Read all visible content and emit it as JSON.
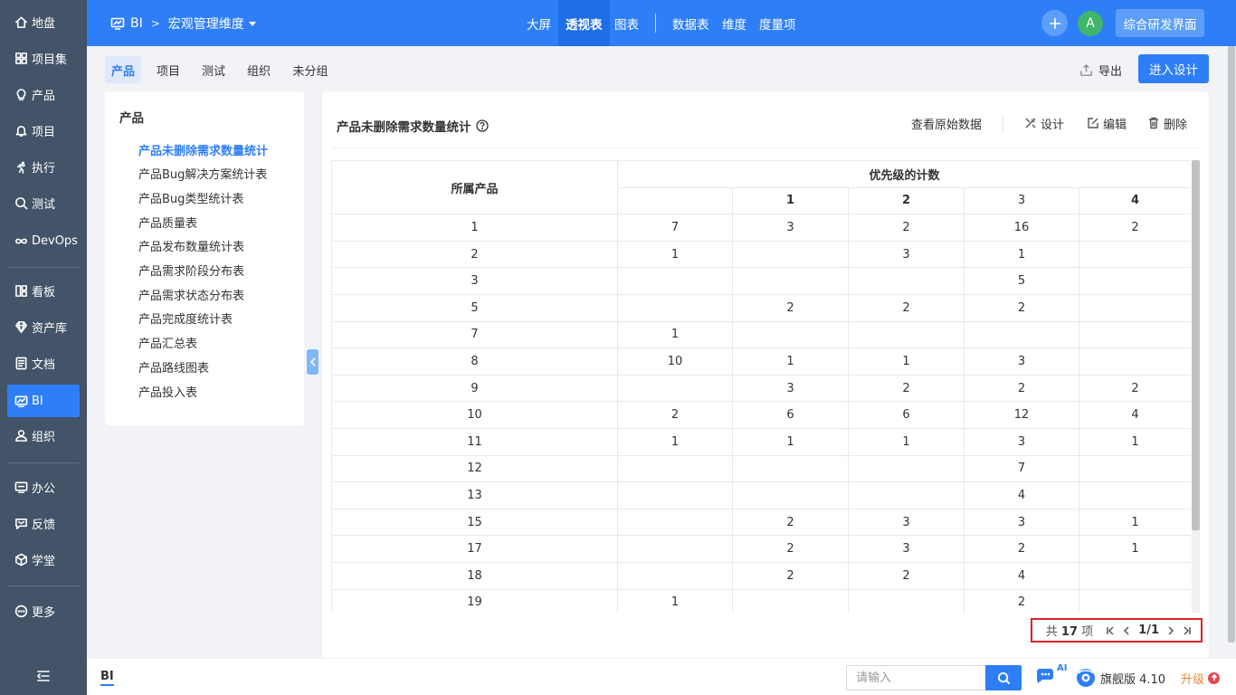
{
  "sidebar": {
    "items": [
      {
        "label": "地盘",
        "icon": "home-icon"
      },
      {
        "label": "项目集",
        "icon": "grid-icon"
      },
      {
        "label": "产品",
        "icon": "lightbulb-icon"
      },
      {
        "label": "项目",
        "icon": "bell-icon"
      },
      {
        "label": "执行",
        "icon": "run-icon"
      },
      {
        "label": "测试",
        "icon": "magnifier-icon"
      },
      {
        "label": "DevOps",
        "icon": "infinity-icon"
      },
      {
        "label": "看板",
        "icon": "board-icon"
      },
      {
        "label": "资产库",
        "icon": "diamond-icon"
      },
      {
        "label": "文档",
        "icon": "document-icon"
      },
      {
        "label": "BI",
        "icon": "monitor-icon",
        "active": true
      },
      {
        "label": "组织",
        "icon": "user-icon"
      },
      {
        "label": "办公",
        "icon": "oa-icon"
      },
      {
        "label": "反馈",
        "icon": "feedback-icon"
      },
      {
        "label": "学堂",
        "icon": "cube-icon"
      },
      {
        "label": "更多",
        "icon": "more-icon"
      }
    ]
  },
  "header": {
    "app": "BI",
    "crumb": "宏观管理维度",
    "nav": [
      {
        "label": "大屏"
      },
      {
        "label": "透视表",
        "active": true
      },
      {
        "label": "图表"
      },
      {
        "label": "数据表"
      },
      {
        "label": "维度"
      },
      {
        "label": "度量项"
      }
    ],
    "avatar": "A",
    "env_label": "综合研发界面"
  },
  "subtabs": [
    "产品",
    "项目",
    "测试",
    "组织",
    "未分组"
  ],
  "toolbar": {
    "export_label": "导出",
    "design_label": "进入设计"
  },
  "leftpanel": {
    "title": "产品",
    "items": [
      "产品未删除需求数量统计",
      "产品Bug解决方案统计表",
      "产品Bug类型统计表",
      "产品质量表",
      "产品发布数量统计表",
      "产品需求阶段分布表",
      "产品需求状态分布表",
      "产品完成度统计表",
      "产品汇总表",
      "产品路线图表",
      "产品投入表"
    ]
  },
  "report": {
    "title": "产品未删除需求数量统计",
    "actions": {
      "view_raw": "查看原始数据",
      "design": "设计",
      "edit": "编辑",
      "delete": "删除"
    }
  },
  "table": {
    "row_header": "所属产品",
    "group_header": "优先级的计数",
    "columns": [
      "",
      "1",
      "2",
      "3",
      "4"
    ],
    "rows": [
      [
        "1",
        "7",
        "3",
        "2",
        "16",
        "2"
      ],
      [
        "2",
        "1",
        "",
        "3",
        "1",
        ""
      ],
      [
        "3",
        "",
        "",
        "",
        "5",
        ""
      ],
      [
        "5",
        "",
        "2",
        "2",
        "2",
        ""
      ],
      [
        "7",
        "1",
        "",
        "",
        "",
        ""
      ],
      [
        "8",
        "10",
        "1",
        "1",
        "3",
        ""
      ],
      [
        "9",
        "",
        "3",
        "2",
        "2",
        "2"
      ],
      [
        "10",
        "2",
        "6",
        "6",
        "12",
        "4"
      ],
      [
        "11",
        "1",
        "1",
        "1",
        "3",
        "1"
      ],
      [
        "12",
        "",
        "",
        "",
        "7",
        ""
      ],
      [
        "13",
        "",
        "",
        "",
        "4",
        ""
      ],
      [
        "15",
        "",
        "2",
        "3",
        "3",
        "1"
      ],
      [
        "17",
        "",
        "2",
        "3",
        "2",
        "1"
      ],
      [
        "18",
        "",
        "2",
        "2",
        "4",
        ""
      ],
      [
        "19",
        "1",
        "",
        "",
        "2",
        ""
      ]
    ]
  },
  "pager": {
    "prefix": "共",
    "total": "17",
    "suffix": "项",
    "current": "1/1"
  },
  "footer": {
    "crumb": "BI",
    "search_placeholder": "请输入",
    "ai_label": "AI",
    "edition": "旗舰版 4.10",
    "upgrade": "升级"
  },
  "colors": {
    "primary": "#2e7ff7",
    "sidebar": "#435368",
    "danger_outline": "#d9232d"
  }
}
